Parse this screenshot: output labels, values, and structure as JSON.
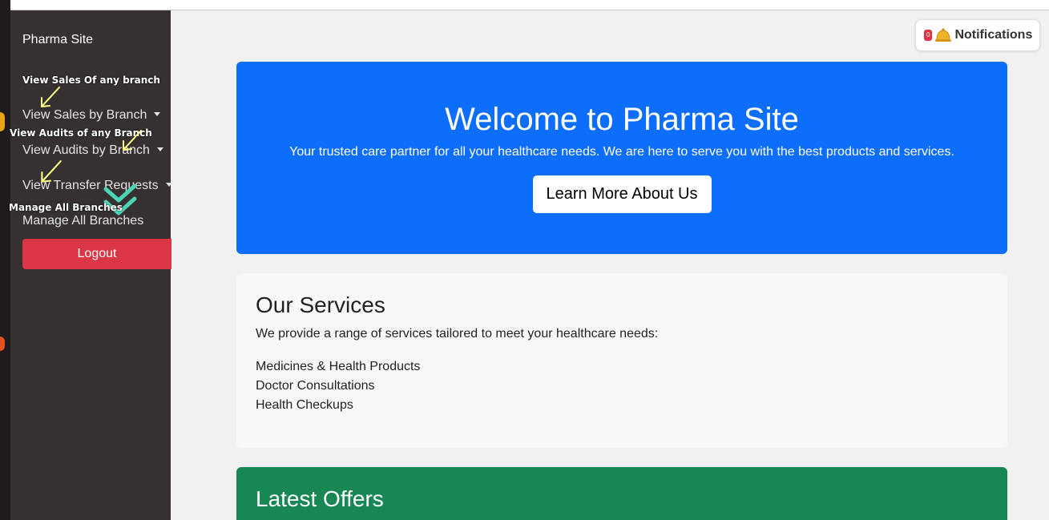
{
  "sidebar": {
    "brand": "Pharma Site",
    "items": [
      {
        "label": "View Sales by Branch"
      },
      {
        "label": "View Audits by Branch"
      },
      {
        "label": "View Transfer Requests"
      },
      {
        "label": "Manage All Branches"
      }
    ],
    "logout": "Logout"
  },
  "annotations": {
    "sales": "View Sales Of any branch",
    "audits": "View Audits of any Branch",
    "branches": "Manage All Branches"
  },
  "notifications": {
    "count": "0",
    "icon": "bell-icon",
    "label": "Notifications"
  },
  "hero": {
    "title": "Welcome to Pharma Site",
    "subtitle": "Your trusted care partner for all your healthcare needs. We are here to serve you with the best products and services.",
    "button": "Learn More About Us"
  },
  "services": {
    "title": "Our Services",
    "intro": "We provide a range of services tailored to meet your healthcare needs:",
    "list": [
      "Medicines & Health Products",
      "Doctor Consultations",
      "Health Checkups"
    ]
  },
  "offers": {
    "title": "Latest Offers"
  },
  "colors": {
    "sidebar": "#363031",
    "hero": "#0d6efd",
    "logout": "#dc3545",
    "offers": "#198754",
    "annotation_arrow": "#ffff8a",
    "annotation_check": "#4dd4b6"
  }
}
